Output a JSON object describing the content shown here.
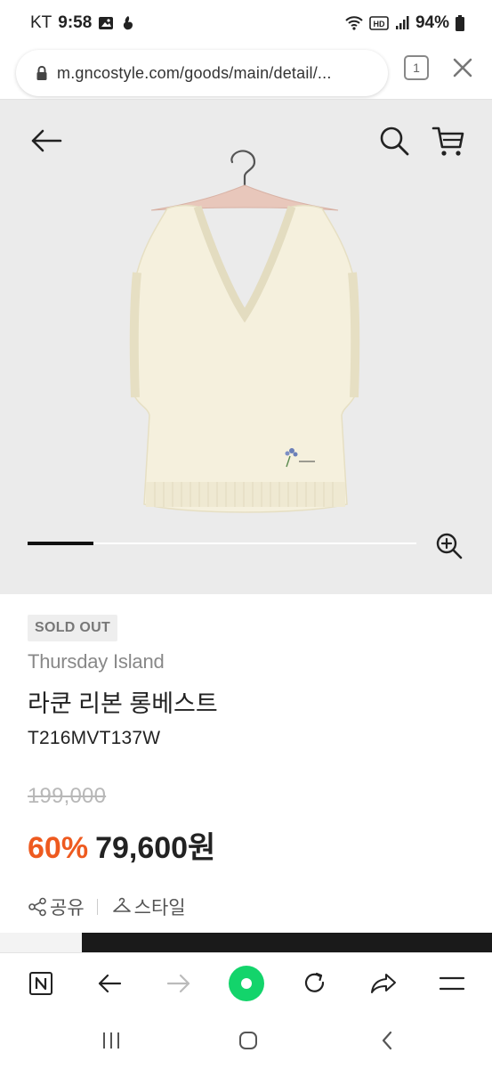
{
  "status_bar": {
    "carrier": "KT",
    "time": "9:58",
    "battery_percent": "94%"
  },
  "browser": {
    "url": "m.gncostyle.com/goods/main/detail/...",
    "tab_count": "1"
  },
  "gallery": {
    "progress_fraction": 0.17
  },
  "product": {
    "status_badge": "SOLD OUT",
    "brand": "Thursday Island",
    "name": "라쿤 리본 롱베스트",
    "code": "T216MVT137W",
    "original_price": "199,000",
    "discount_rate": "60%",
    "sale_price": "79,600원"
  },
  "actions": {
    "share_label": "공유",
    "style_label": "스타일"
  },
  "colors": {
    "discount": "#ee5a1f",
    "home_button": "#13d46b",
    "hero_background": "#ebebeb"
  }
}
